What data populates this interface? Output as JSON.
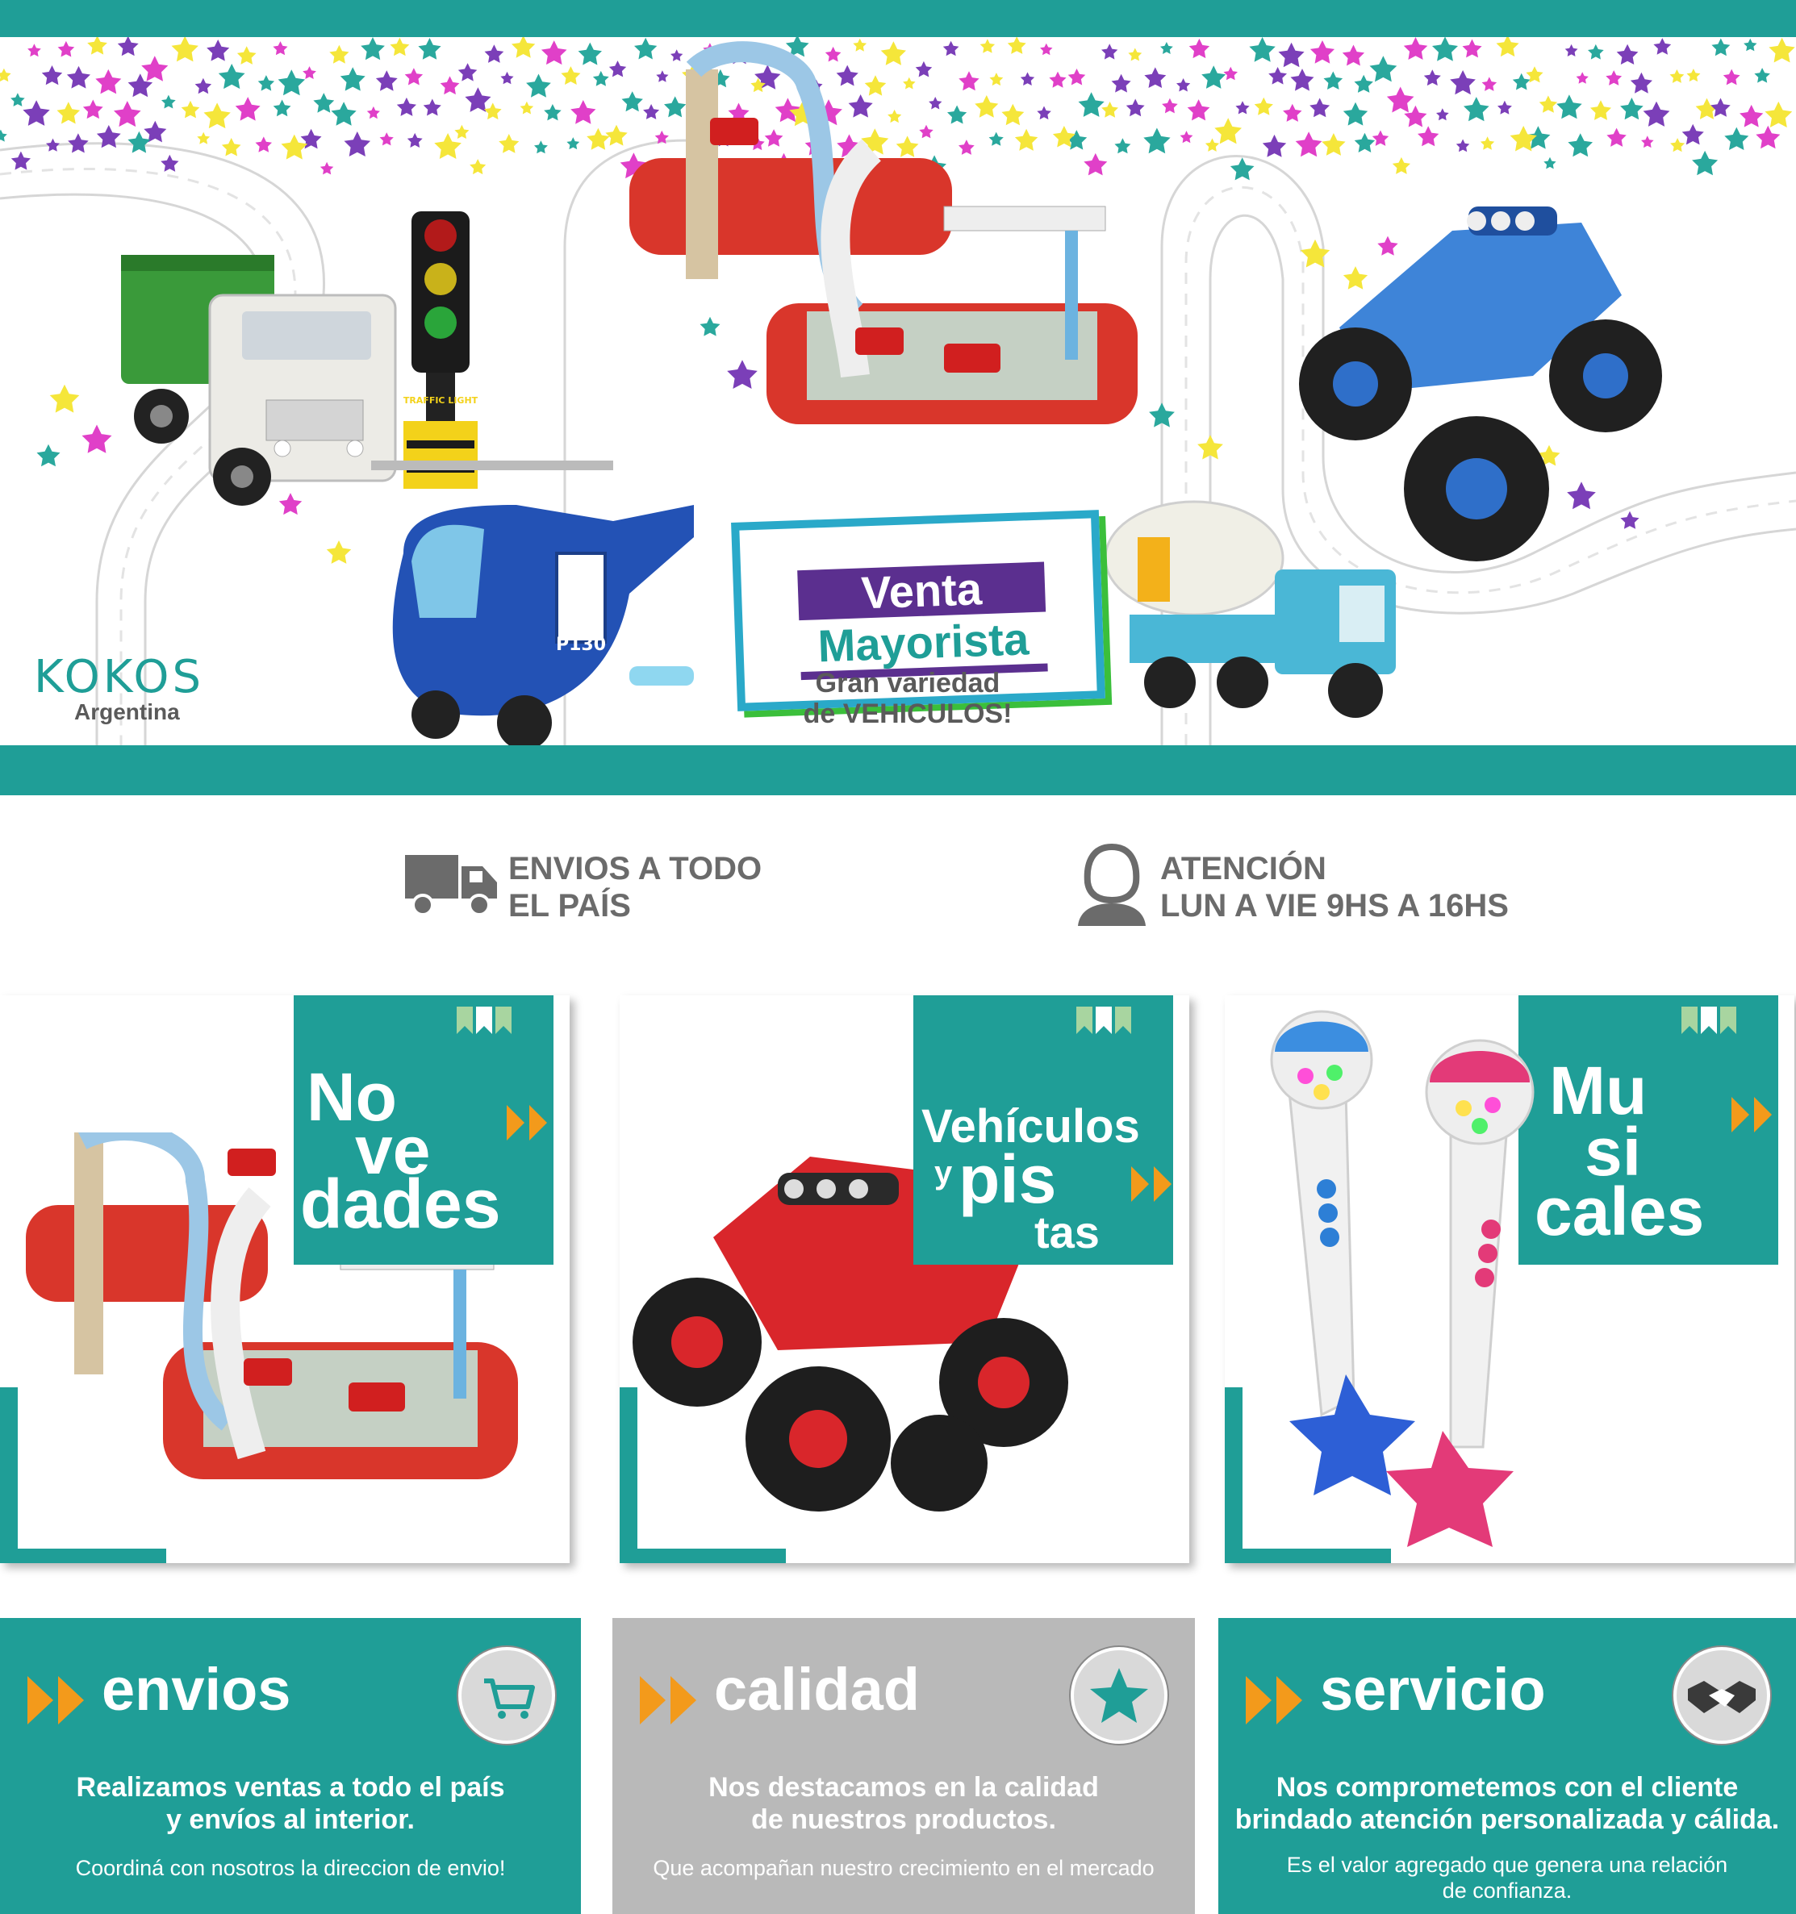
{
  "brand": {
    "name": "KOKOS",
    "subtitle": "Argentina"
  },
  "hero": {
    "promo_line1": "Venta",
    "promo_line2": "Mayorista",
    "tagline_line1": "Gran variedad",
    "tagline_line2": "de VEHICULOS!",
    "traffic_light_label": "TRAFFIC LIGHT",
    "helicopter_label": "P130"
  },
  "info": {
    "shipping_line1": "ENVIOS A TODO",
    "shipping_line2": "EL PAÍS",
    "attention_line1": "ATENCIÓN",
    "attention_line2": "LUN A VIE 9HS A 16HS"
  },
  "categories": [
    {
      "title_parts": [
        "No",
        "ve",
        "dades"
      ]
    },
    {
      "title_parts": [
        "Vehículos",
        "y",
        "pis",
        "tas"
      ]
    },
    {
      "title_parts": [
        "Mu",
        "si",
        "cales"
      ]
    }
  ],
  "features": [
    {
      "title": "envios",
      "lead_line1": "Realizamos ventas a todo el país",
      "lead_line2": "y envíos al interior.",
      "sub_line1": "Coordiná con nosotros la direccion de envio!",
      "sub_line2": ""
    },
    {
      "title": "calidad",
      "lead_line1": "Nos destacamos en la calidad",
      "lead_line2": "de nuestros productos.",
      "sub_line1": "Que acompañan nuestro crecimiento en el mercado",
      "sub_line2": ""
    },
    {
      "title": "servicio",
      "lead_line1": "Nos comprometemos con el cliente",
      "lead_line2": "brindado atención personalizada y cálida.",
      "sub_line1": "Es el valor agregado que genera una relación",
      "sub_line2": "de confianza."
    }
  ],
  "colors": {
    "teal": "#1f9e97",
    "gray_panel": "#b9b9b9",
    "orange": "#f39a1b",
    "purple": "#5b2f8f",
    "text_gray": "#6b6b6b"
  }
}
